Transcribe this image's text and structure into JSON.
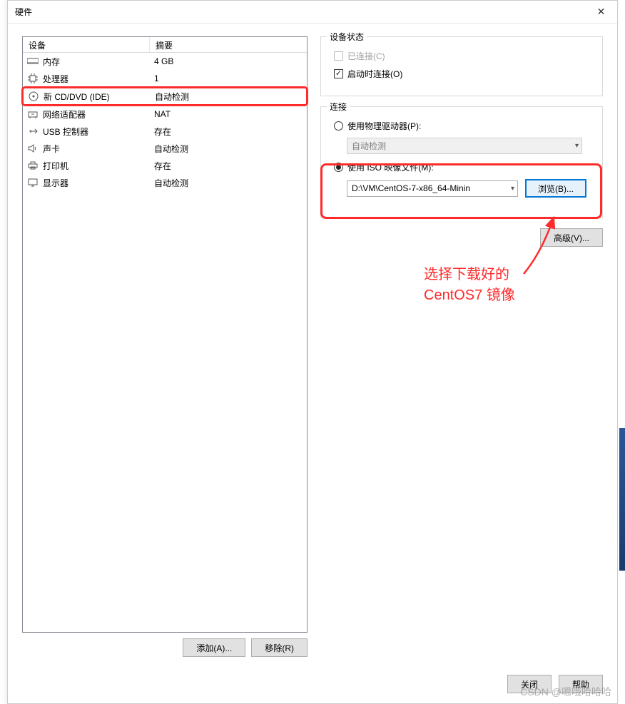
{
  "window": {
    "title": "硬件",
    "close_tooltip": "Close"
  },
  "list": {
    "header_device": "设备",
    "header_summary": "摘要",
    "rows": [
      {
        "icon": "memory",
        "name": "内存",
        "summary": "4 GB"
      },
      {
        "icon": "cpu",
        "name": "处理器",
        "summary": "1"
      },
      {
        "icon": "disc",
        "name": "新 CD/DVD (IDE)",
        "summary": "自动检测",
        "selected": true
      },
      {
        "icon": "network",
        "name": "网络适配器",
        "summary": "NAT"
      },
      {
        "icon": "usb",
        "name": "USB 控制器",
        "summary": "存在"
      },
      {
        "icon": "sound",
        "name": "声卡",
        "summary": "自动检测"
      },
      {
        "icon": "printer",
        "name": "打印机",
        "summary": "存在"
      },
      {
        "icon": "display",
        "name": "显示器",
        "summary": "自动检测"
      }
    ]
  },
  "left_buttons": {
    "add": "添加(A)...",
    "remove": "移除(R)"
  },
  "status_group": {
    "title": "设备状态",
    "connected_label": "已连接(C)",
    "connect_on_start_label": "启动时连接(O)"
  },
  "conn_group": {
    "title": "连接",
    "physical_label": "使用物理驱动器(P):",
    "physical_value": "自动检测",
    "iso_label": "使用 ISO 映像文件(M):",
    "iso_value": "D:\\VM\\CentOS-7-x86_64-Minin",
    "browse_label": "浏览(B)...",
    "advanced_label": "高级(V)..."
  },
  "annotation": {
    "line1": "选择下载好的",
    "line2": "CentOS7 镜像"
  },
  "bottom": {
    "close": "关闭",
    "help": "帮助"
  },
  "watermark": "CSDN @嗯哦哈哈哈"
}
